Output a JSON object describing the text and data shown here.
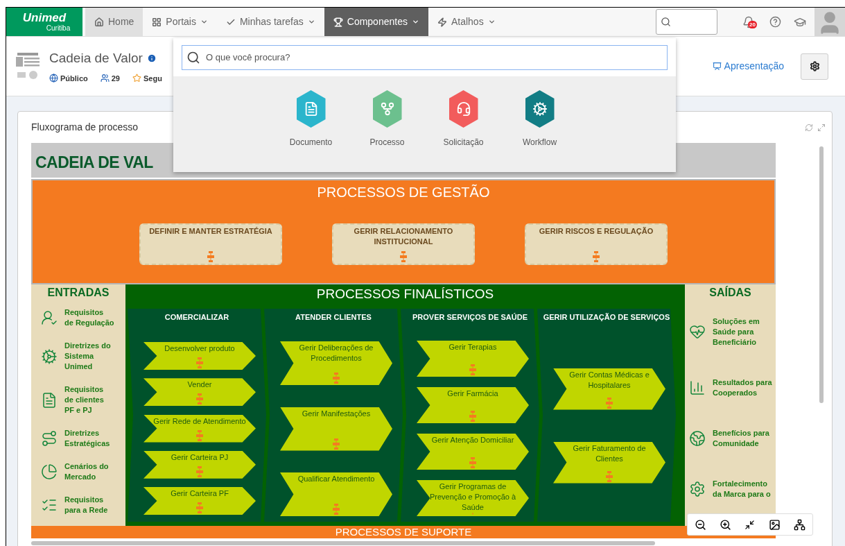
{
  "nav": {
    "logo": {
      "brand": "Unimed",
      "city": "Curitiba"
    },
    "tabs": [
      {
        "label": "Home",
        "kind": "home",
        "selected": true,
        "open": false,
        "has_menu": false
      },
      {
        "label": "Portais",
        "kind": "portals",
        "selected": false,
        "open": false,
        "has_menu": true
      },
      {
        "label": "Minhas tarefas",
        "kind": "tasks",
        "selected": false,
        "open": false,
        "has_menu": true
      },
      {
        "label": "Componentes",
        "kind": "components",
        "selected": false,
        "open": true,
        "has_menu": true
      },
      {
        "label": "Atalhos",
        "kind": "shortcuts",
        "selected": false,
        "open": false,
        "has_menu": true
      }
    ],
    "notifications": {
      "badge": "20"
    }
  },
  "header": {
    "title": "Cadeia de Valor",
    "meta": [
      {
        "kind": "visibility",
        "label": "Público"
      },
      {
        "kind": "members",
        "label": "29"
      },
      {
        "kind": "follow",
        "label": "Segu"
      }
    ],
    "presentation": "Apresentação"
  },
  "components_menu": {
    "placeholder": "O que você procura?",
    "items": [
      {
        "label": "Documento",
        "kind": "document",
        "color": "#2bb5cc"
      },
      {
        "label": "Processo",
        "kind": "process",
        "color": "#6cc08e"
      },
      {
        "label": "Solicitação",
        "kind": "request",
        "color": "#f25c5c"
      },
      {
        "label": "Workflow",
        "kind": "workflow",
        "color": "#127d85"
      }
    ]
  },
  "card": {
    "title": "Fluxograma de processo"
  },
  "diagram": {
    "title": "CADEIA DE VAL",
    "management": {
      "title": "PROCESSOS DE GESTÃO",
      "processes": [
        "DEFINIR E MANTER ESTRATÉGIA",
        "GERIR RELACIONAMENTO INSTITUCIONAL",
        "GERIR RISCOS E REGULAÇÃO"
      ]
    },
    "inputs": {
      "title": "ENTRADAS",
      "items": [
        {
          "label": "Requisitos de Regulação",
          "kind": "regulation"
        },
        {
          "label": "Diretrizes do Sistema Unimed",
          "kind": "guidelines"
        },
        {
          "label": "Requisitos de clientes PF e PJ",
          "kind": "document"
        },
        {
          "label": "Diretrizes Estratégicas",
          "kind": "strategy"
        },
        {
          "label": "Cenários do Mercado",
          "kind": "market"
        },
        {
          "label": "Requisitos para a Rede",
          "kind": "checklist"
        }
      ]
    },
    "core": {
      "title": "PROCESSOS FINALÍSTICOS",
      "columns": [
        {
          "title": "COMERCIALIZAR",
          "processes": [
            "Desenvolver produto",
            "Vender",
            "Gerir Rede de Atendimento",
            "Gerir Carteira PJ",
            "Gerir Carteira PF"
          ]
        },
        {
          "title": "ATENDER CLIENTES",
          "processes": [
            "Gerir Deliberações de Procedimentos",
            "Gerir Manifestações",
            "Qualificar Atendimento"
          ]
        },
        {
          "title": "PROVER SERVIÇOS DE SAÚDE",
          "processes": [
            "Gerir Terapias",
            "Gerir Farmácia",
            "Gerir Atenção Domiciliar",
            "Gerir Programas de Prevenção e Promoção à Saúde"
          ]
        },
        {
          "title": "GERIR UTILIZAÇÃO DE SERVIÇOS",
          "processes": [
            "Gerir Contas Médicas e Hospitalares",
            "Gerir Faturamento de Clientes"
          ]
        }
      ]
    },
    "outputs": {
      "title": "SAÍDAS",
      "items": [
        {
          "label": "Soluções em Saúde para Beneficiário",
          "kind": "health"
        },
        {
          "label": "Resultados para Cooperados",
          "kind": "results"
        },
        {
          "label": "Benefícios para Comunidade",
          "kind": "community"
        },
        {
          "label": "Fortalecimento da Marca para o",
          "kind": "brand"
        }
      ]
    },
    "support": {
      "title": "PROCESSOS DE SUPORTE"
    }
  }
}
